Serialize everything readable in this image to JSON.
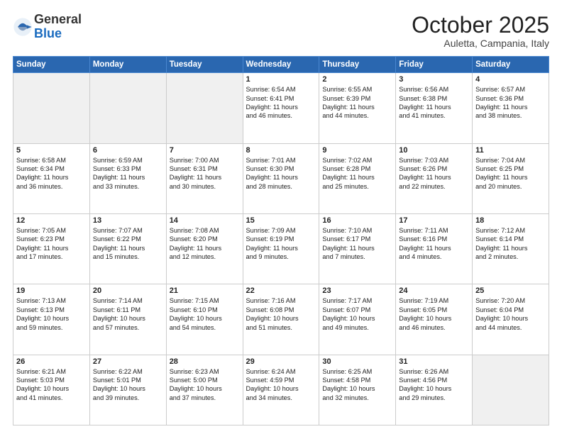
{
  "logo": {
    "general": "General",
    "blue": "Blue"
  },
  "header": {
    "month": "October 2025",
    "location": "Auletta, Campania, Italy"
  },
  "days_of_week": [
    "Sunday",
    "Monday",
    "Tuesday",
    "Wednesday",
    "Thursday",
    "Friday",
    "Saturday"
  ],
  "weeks": [
    [
      {
        "day": "",
        "empty": true
      },
      {
        "day": "",
        "empty": true
      },
      {
        "day": "",
        "empty": true
      },
      {
        "day": "1",
        "lines": [
          "Sunrise: 6:54 AM",
          "Sunset: 6:41 PM",
          "Daylight: 11 hours",
          "and 46 minutes."
        ]
      },
      {
        "day": "2",
        "lines": [
          "Sunrise: 6:55 AM",
          "Sunset: 6:39 PM",
          "Daylight: 11 hours",
          "and 44 minutes."
        ]
      },
      {
        "day": "3",
        "lines": [
          "Sunrise: 6:56 AM",
          "Sunset: 6:38 PM",
          "Daylight: 11 hours",
          "and 41 minutes."
        ]
      },
      {
        "day": "4",
        "lines": [
          "Sunrise: 6:57 AM",
          "Sunset: 6:36 PM",
          "Daylight: 11 hours",
          "and 38 minutes."
        ]
      }
    ],
    [
      {
        "day": "5",
        "lines": [
          "Sunrise: 6:58 AM",
          "Sunset: 6:34 PM",
          "Daylight: 11 hours",
          "and 36 minutes."
        ]
      },
      {
        "day": "6",
        "lines": [
          "Sunrise: 6:59 AM",
          "Sunset: 6:33 PM",
          "Daylight: 11 hours",
          "and 33 minutes."
        ]
      },
      {
        "day": "7",
        "lines": [
          "Sunrise: 7:00 AM",
          "Sunset: 6:31 PM",
          "Daylight: 11 hours",
          "and 30 minutes."
        ]
      },
      {
        "day": "8",
        "lines": [
          "Sunrise: 7:01 AM",
          "Sunset: 6:30 PM",
          "Daylight: 11 hours",
          "and 28 minutes."
        ]
      },
      {
        "day": "9",
        "lines": [
          "Sunrise: 7:02 AM",
          "Sunset: 6:28 PM",
          "Daylight: 11 hours",
          "and 25 minutes."
        ]
      },
      {
        "day": "10",
        "lines": [
          "Sunrise: 7:03 AM",
          "Sunset: 6:26 PM",
          "Daylight: 11 hours",
          "and 22 minutes."
        ]
      },
      {
        "day": "11",
        "lines": [
          "Sunrise: 7:04 AM",
          "Sunset: 6:25 PM",
          "Daylight: 11 hours",
          "and 20 minutes."
        ]
      }
    ],
    [
      {
        "day": "12",
        "lines": [
          "Sunrise: 7:05 AM",
          "Sunset: 6:23 PM",
          "Daylight: 11 hours",
          "and 17 minutes."
        ]
      },
      {
        "day": "13",
        "lines": [
          "Sunrise: 7:07 AM",
          "Sunset: 6:22 PM",
          "Daylight: 11 hours",
          "and 15 minutes."
        ]
      },
      {
        "day": "14",
        "lines": [
          "Sunrise: 7:08 AM",
          "Sunset: 6:20 PM",
          "Daylight: 11 hours",
          "and 12 minutes."
        ]
      },
      {
        "day": "15",
        "lines": [
          "Sunrise: 7:09 AM",
          "Sunset: 6:19 PM",
          "Daylight: 11 hours",
          "and 9 minutes."
        ]
      },
      {
        "day": "16",
        "lines": [
          "Sunrise: 7:10 AM",
          "Sunset: 6:17 PM",
          "Daylight: 11 hours",
          "and 7 minutes."
        ]
      },
      {
        "day": "17",
        "lines": [
          "Sunrise: 7:11 AM",
          "Sunset: 6:16 PM",
          "Daylight: 11 hours",
          "and 4 minutes."
        ]
      },
      {
        "day": "18",
        "lines": [
          "Sunrise: 7:12 AM",
          "Sunset: 6:14 PM",
          "Daylight: 11 hours",
          "and 2 minutes."
        ]
      }
    ],
    [
      {
        "day": "19",
        "lines": [
          "Sunrise: 7:13 AM",
          "Sunset: 6:13 PM",
          "Daylight: 10 hours",
          "and 59 minutes."
        ]
      },
      {
        "day": "20",
        "lines": [
          "Sunrise: 7:14 AM",
          "Sunset: 6:11 PM",
          "Daylight: 10 hours",
          "and 57 minutes."
        ]
      },
      {
        "day": "21",
        "lines": [
          "Sunrise: 7:15 AM",
          "Sunset: 6:10 PM",
          "Daylight: 10 hours",
          "and 54 minutes."
        ]
      },
      {
        "day": "22",
        "lines": [
          "Sunrise: 7:16 AM",
          "Sunset: 6:08 PM",
          "Daylight: 10 hours",
          "and 51 minutes."
        ]
      },
      {
        "day": "23",
        "lines": [
          "Sunrise: 7:17 AM",
          "Sunset: 6:07 PM",
          "Daylight: 10 hours",
          "and 49 minutes."
        ]
      },
      {
        "day": "24",
        "lines": [
          "Sunrise: 7:19 AM",
          "Sunset: 6:05 PM",
          "Daylight: 10 hours",
          "and 46 minutes."
        ]
      },
      {
        "day": "25",
        "lines": [
          "Sunrise: 7:20 AM",
          "Sunset: 6:04 PM",
          "Daylight: 10 hours",
          "and 44 minutes."
        ]
      }
    ],
    [
      {
        "day": "26",
        "lines": [
          "Sunrise: 6:21 AM",
          "Sunset: 5:03 PM",
          "Daylight: 10 hours",
          "and 41 minutes."
        ]
      },
      {
        "day": "27",
        "lines": [
          "Sunrise: 6:22 AM",
          "Sunset: 5:01 PM",
          "Daylight: 10 hours",
          "and 39 minutes."
        ]
      },
      {
        "day": "28",
        "lines": [
          "Sunrise: 6:23 AM",
          "Sunset: 5:00 PM",
          "Daylight: 10 hours",
          "and 37 minutes."
        ]
      },
      {
        "day": "29",
        "lines": [
          "Sunrise: 6:24 AM",
          "Sunset: 4:59 PM",
          "Daylight: 10 hours",
          "and 34 minutes."
        ]
      },
      {
        "day": "30",
        "lines": [
          "Sunrise: 6:25 AM",
          "Sunset: 4:58 PM",
          "Daylight: 10 hours",
          "and 32 minutes."
        ]
      },
      {
        "day": "31",
        "lines": [
          "Sunrise: 6:26 AM",
          "Sunset: 4:56 PM",
          "Daylight: 10 hours",
          "and 29 minutes."
        ]
      },
      {
        "day": "",
        "empty": true
      }
    ]
  ]
}
